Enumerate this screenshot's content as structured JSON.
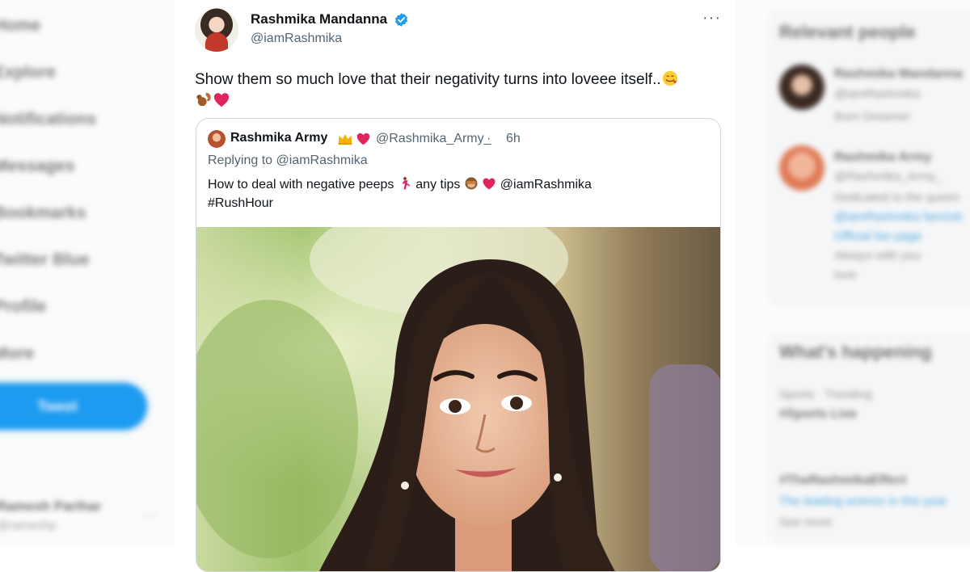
{
  "sidebar": {
    "items": [
      "Home",
      "Explore",
      "Notifications",
      "Messages",
      "Bookmarks",
      "Twitter Blue",
      "Profile",
      "More"
    ],
    "post_label": "Tweet",
    "account_name": "Ramesh Parihar",
    "account_handle": "@rameshp"
  },
  "tweet": {
    "author_name": "Rashmika Mandanna",
    "author_handle": "@iamRashmika",
    "more_label": "···",
    "text": "Show them so much love that their negativity turns into loveee itself..",
    "emoji": [
      "smiling-face-with-hearts",
      "squirrel",
      "red-heart"
    ],
    "verified_color": "#1d9bf0"
  },
  "quoted_tweet": {
    "author_name": "Rashmika Army",
    "author_emoji": [
      "crown",
      "red-heart"
    ],
    "author_handle": "@Rashmika_Army_",
    "separator": "·",
    "time": "6h",
    "reply_prefix": "Replying to ",
    "reply_to": "@iamRashmika",
    "text_part1": "How to deal with negative peeps",
    "text_part2": "any tips",
    "mention": "@iamRashmika",
    "hashtag": "#RushHour",
    "text_emoji": [
      "woman-dancing",
      "see-no-evil-monkey",
      "red-heart"
    ],
    "media_description": "photo"
  },
  "right_sidebar": {
    "relevant_title": "Relevant people",
    "person1_name": "Rashmika Mandanna",
    "person1_handle": "@iamRashmika",
    "person1_bio": "Born Dreamer",
    "person2_name": "Rashmika Army",
    "person2_handle": "@Rashmika_Army_",
    "person2_bio1": "Dedicated to the queen",
    "person2_bio2": "@iamRashmika fanclub",
    "person2_bio3": "Official fan page",
    "person2_bio4": "Always with you",
    "person2_bio5": "love",
    "happening_title": "What's happening",
    "trend1_meta": "Sports · Trending",
    "trend1_name": "#Sports Live",
    "trend2_name": "#TheRashmikaEffect",
    "trend2_text": "The leading actress in this year",
    "trend2_more": "See more"
  }
}
